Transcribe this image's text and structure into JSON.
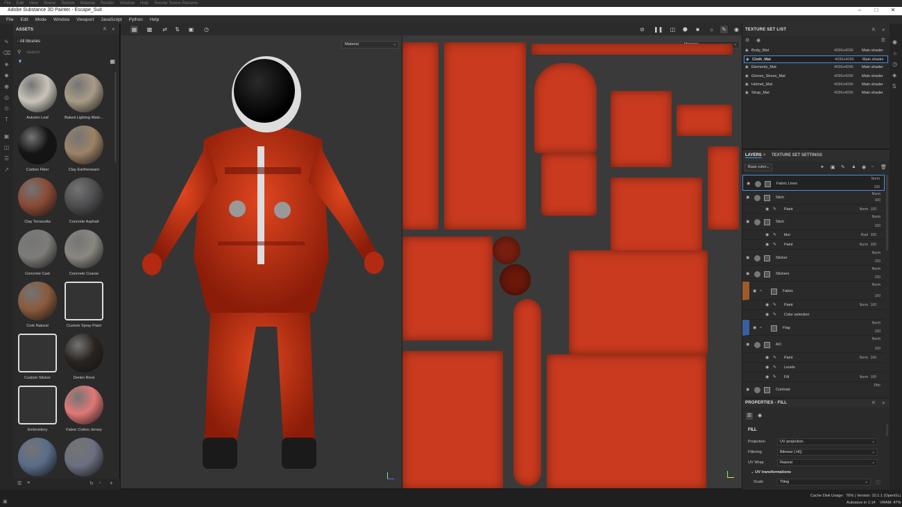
{
  "window": {
    "title": "Adobe Substance 3D Painter - Escape_Suit",
    "ghost_menu": [
      "File",
      "Edit",
      "View",
      "Scene",
      "Texture",
      "Material",
      "Render",
      "Window",
      "Help",
      "Render Scene Rename"
    ]
  },
  "menu": [
    "File",
    "Edit",
    "Mode",
    "Window",
    "Viewport",
    "JavaScript",
    "Python",
    "Help"
  ],
  "assets": {
    "title": "ASSETS",
    "library": "All libraries",
    "search_placeholder": "Search",
    "items": [
      "Autumn Leaf",
      "Baked Lighting Mate...",
      "Carbon Fiber",
      "Clay Earthenware",
      "Clay Terracotta",
      "Concrete Asphalt",
      "Concrete Cast",
      "Concrete Coarse",
      "Cork Natural",
      "Custom Spray Paint",
      "Custom Sticker",
      "Denim Rivet",
      "Embroidery",
      "Fabric Cotton Jersey",
      "",
      ""
    ],
    "colors": [
      "#c9c4b9",
      "#a89c88",
      "#151515",
      "#9d8266",
      "#8a4a35",
      "#4e4e50",
      "#7d7c79",
      "#8a8780",
      "#8a5a3c",
      "#ffffff",
      "#ffffff",
      "#2a2420",
      "#ffffff",
      "#e07876",
      "#5a6d88",
      "#6b7080"
    ]
  },
  "viewport": {
    "left_mode": "Material",
    "right_mode": "Material"
  },
  "texture_set_list": {
    "title": "TEXTURE SET LIST",
    "rows": [
      {
        "name": "Body_Mat",
        "res": "4096x4096",
        "shader": "Main shader"
      },
      {
        "name": "Cloth_Mat",
        "res": "4096x4096",
        "shader": "Main shader"
      },
      {
        "name": "Elements_Mat",
        "res": "4096x4096",
        "shader": "Main shader"
      },
      {
        "name": "Gloves_Shoes_Mat",
        "res": "4096x4096",
        "shader": "Main shader"
      },
      {
        "name": "Helmet_Mat",
        "res": "4096x4096",
        "shader": "Main shader"
      },
      {
        "name": "Strap_Mat",
        "res": "4096x4096",
        "shader": "Main shader"
      }
    ]
  },
  "layers": {
    "tab_layers": "LAYERS",
    "tab_settings": "TEXTURE SET SETTINGS",
    "channel": "Base color",
    "rows": [
      {
        "name": "Fabric Linen",
        "blend": "Norm",
        "opacity": "100"
      },
      {
        "name": "Stich",
        "blend": "Norm",
        "opacity": "100"
      },
      {
        "name": "Paint",
        "blend": "Norm",
        "opacity": "100"
      },
      {
        "name": "Stich",
        "blend": "Norm",
        "opacity": "100"
      },
      {
        "name": "blur",
        "blend": "Repl",
        "opacity": "100"
      },
      {
        "name": "Paint",
        "blend": "Norm",
        "opacity": "100"
      },
      {
        "name": "Sticker",
        "blend": "Norm",
        "opacity": "100"
      },
      {
        "name": "Stickers",
        "blend": "Norm",
        "opacity": "100"
      },
      {
        "name": "Fabric",
        "blend": "Norm",
        "opacity": "100"
      },
      {
        "name": "Paint",
        "blend": "Norm",
        "opacity": "100"
      },
      {
        "name": "Color selection",
        "blend": "",
        "opacity": ""
      },
      {
        "name": "Flag",
        "blend": "Norm",
        "opacity": "100"
      },
      {
        "name": "AO",
        "blend": "Norm",
        "opacity": "100"
      },
      {
        "name": "Paint",
        "blend": "Norm",
        "opacity": "100"
      },
      {
        "name": "Levels",
        "blend": "",
        "opacity": ""
      },
      {
        "name": "Fill",
        "blend": "Norm",
        "opacity": "100"
      },
      {
        "name": "Contrast",
        "blend": "Pthr",
        "opacity": ""
      }
    ]
  },
  "properties": {
    "title": "PROPERTIES - FILL",
    "section": "FILL",
    "projection_label": "Projection",
    "projection": "UV projection",
    "filtering_label": "Filtering",
    "filtering": "Bilinear | HQ",
    "uvwrap_label": "UV Wrap",
    "uvwrap": "Repeat",
    "uvtrans": "UV transformations",
    "scale_label": "Scale",
    "scale": "Tiling"
  },
  "status": {
    "disk": "Cache Disk Usage:",
    "version": "76% | Version: 10.1.1 (OpenGL)",
    "autosave": "Autosave in 1:14",
    "vram": "VRAM: 47%"
  }
}
